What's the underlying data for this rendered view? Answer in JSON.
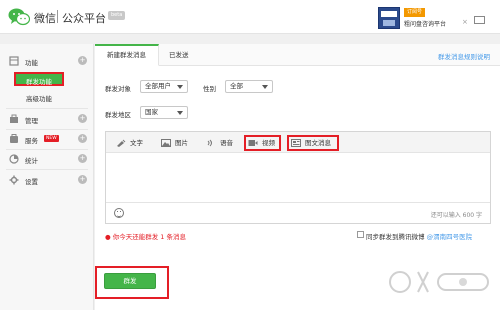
{
  "header": {
    "logo_text": "微信",
    "platform_text": "公众平台",
    "beta_tag": "beta",
    "account_tag": "订阅号",
    "account_name": "粗问盘咨询平台",
    "close_glyph": "×",
    "icons": [
      "wechat-logo-icon",
      "mail-icon"
    ]
  },
  "sidebar": {
    "sections": [
      {
        "label": "功能",
        "icon": "function-icon",
        "subitems": [
          {
            "label": "群发功能",
            "active": true
          },
          {
            "label": "高级功能",
            "active": false
          }
        ]
      },
      {
        "label": "管理",
        "icon": "manage-icon"
      },
      {
        "label": "服务",
        "icon": "service-icon",
        "badge": "NEW"
      },
      {
        "label": "统计",
        "icon": "stats-icon"
      },
      {
        "label": "设置",
        "icon": "settings-icon"
      }
    ],
    "plus_glyph": "+"
  },
  "tabs": [
    {
      "label": "新建群发消息",
      "active": true
    },
    {
      "label": "已发送",
      "active": false
    }
  ],
  "rules_link": "群发消息规则说明",
  "form": {
    "target_label": "群发对象",
    "target_value": "全部用户",
    "gender_label": "性别",
    "gender_value": "全部",
    "region_label": "群发地区",
    "region_value": "国家"
  },
  "message_types": [
    {
      "label": "文字",
      "icon": "text-icon"
    },
    {
      "label": "图片",
      "icon": "image-icon"
    },
    {
      "label": "语音",
      "icon": "voice-icon"
    },
    {
      "label": "视频",
      "icon": "video-icon"
    },
    {
      "label": "图文消息",
      "icon": "news-icon"
    }
  ],
  "editor": {
    "counter_text": "还可以输入 600 字"
  },
  "limit_note": "● 你今天还能群发 1 条消息",
  "sync": {
    "text": "同步群发到腾讯微博",
    "link": "@渭南四号医院"
  },
  "send_button": "群发",
  "colors": {
    "accent": "#44b549",
    "highlight": "#e41e26",
    "link": "#459ae9"
  }
}
